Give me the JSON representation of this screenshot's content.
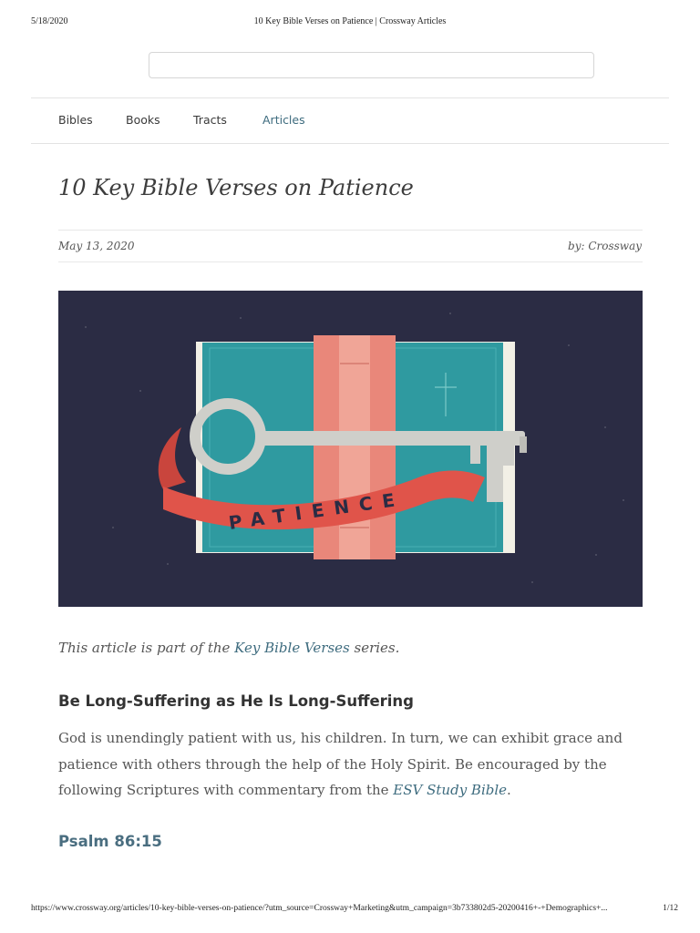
{
  "print_header": {
    "date": "5/18/2020",
    "title": "10 Key Bible Verses on Patience | Crossway Articles"
  },
  "search": {
    "placeholder": ""
  },
  "nav": {
    "items": [
      {
        "label": "Bibles"
      },
      {
        "label": "Books"
      },
      {
        "label": "Tracts"
      },
      {
        "label": "Articles",
        "active": true
      }
    ]
  },
  "article": {
    "title": "10 Key Bible Verses on Patience",
    "date": "May 13, 2020",
    "byline": "by: Crossway",
    "hero": {
      "banner_text": "PATIENCE",
      "icon_names": [
        "book-icon",
        "key-icon",
        "cross-icon",
        "ribbon-banner"
      ]
    },
    "series_intro": {
      "prefix": "This article is part of the ",
      "link": "Key Bible Verses",
      "suffix": " series."
    },
    "section_heading": "Be Long-Suffering as He Is Long-Suffering",
    "paragraph": {
      "line1": "God is unendingly patient with us, his children. In turn, we can exhibit grace and",
      "line2": "patience with others through the help of the Holy Spirit. Be encouraged by the",
      "line3_prefix": "following Scriptures with commentary from the ",
      "line3_link": "ESV Study Bible",
      "line3_suffix": "."
    },
    "subheading": "Psalm 86:15"
  },
  "print_footer": {
    "url": "https://www.crossway.org/articles/10-key-bible-verses-on-patience/?utm_source=Crossway+Marketing&utm_campaign=3b733802d5-20200416+-+Demographics+...",
    "page": "1/12"
  },
  "colors": {
    "link": "#3d6b7e",
    "hero_background": "#2b2c44",
    "book_teal": "#2f9aa0",
    "ribbon_red": "#e0544a",
    "key_grey": "#cfcfca"
  }
}
